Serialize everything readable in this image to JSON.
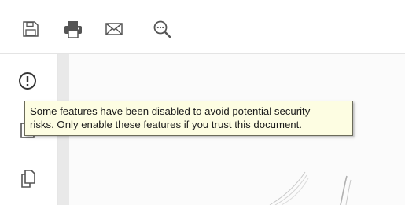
{
  "toolbar": {
    "icons": [
      "save-icon",
      "print-icon",
      "email-icon",
      "search-comment-icon"
    ]
  },
  "side_panel": {
    "icons": [
      "alert-circle-icon",
      "attachment-icon",
      "copy-pages-icon"
    ]
  },
  "tooltip": {
    "line1": "Some features have been disabled to avoid potential security",
    "line2": "risks. Only enable these features if you trust this document."
  },
  "colors": {
    "icon": "#555555",
    "tooltip_bg": "#fdfde2",
    "tooltip_border": "#6b6b5a"
  }
}
